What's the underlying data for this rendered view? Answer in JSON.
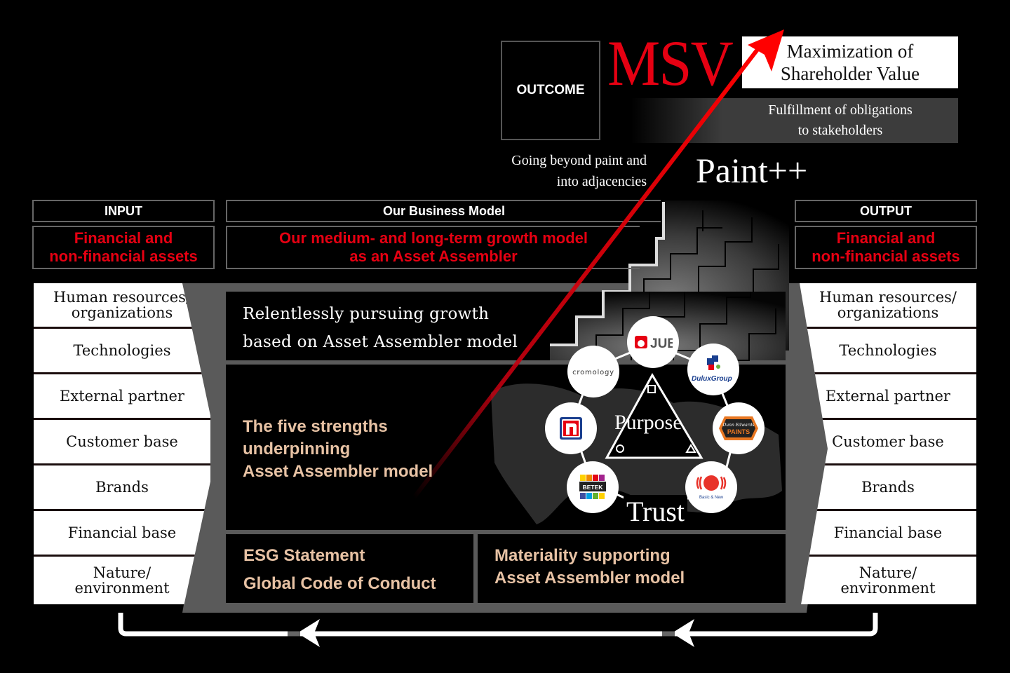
{
  "outcome": {
    "label": "OUTCOME",
    "msv": "MSV",
    "msv_full": [
      "Maximization of",
      "Shareholder Value"
    ],
    "fulfillment": [
      "Fulfillment of obligations",
      "to stakeholders"
    ],
    "going_beyond": [
      "Going beyond paint and",
      "into adjacencies"
    ],
    "paint_plus": "Paint++"
  },
  "input": {
    "header": "INPUT",
    "subheader": [
      "Financial and",
      "non-financial assets"
    ],
    "items": [
      [
        "Human resources/",
        "organizations"
      ],
      [
        "Technologies"
      ],
      [
        "External partner"
      ],
      [
        "Customer base"
      ],
      [
        "Brands"
      ],
      [
        "Financial base"
      ],
      [
        "Nature/",
        "environment"
      ]
    ]
  },
  "business_model": {
    "header": "Our Business Model",
    "subheader": [
      "Our medium- and long-term growth model",
      "as an Asset Assembler"
    ],
    "growth": [
      "Relentlessly pursuing growth",
      "based on Asset Assembler model"
    ],
    "strengths": [
      "The five strengths",
      "underpinning",
      "Asset Assembler model"
    ],
    "esg": [
      "ESG Statement",
      "Global Code of Conduct"
    ],
    "materiality": [
      "Materiality supporting",
      "Asset Assembler model"
    ],
    "purpose": "Purpose",
    "trust": "Trust",
    "brands": [
      {
        "name": "JUB",
        "icon": "jub-logo"
      },
      {
        "name": "DuluxGroup",
        "icon": "duluxgroup-logo"
      },
      {
        "name": "Dunn-Edwards PAINTS",
        "icon": "dunn-edwards-logo"
      },
      {
        "name": "Basic & New",
        "icon": "basic-new-logo"
      },
      {
        "name": "BETEK",
        "icon": "betek-logo"
      },
      {
        "name": "n",
        "icon": "nippon-paint-logo"
      },
      {
        "name": "cromology",
        "icon": "cromology-logo"
      }
    ]
  },
  "output": {
    "header": "OUTPUT",
    "subheader": [
      "Financial and",
      "non-financial assets"
    ],
    "items": [
      [
        "Human resources/",
        "organizations"
      ],
      [
        "Technologies"
      ],
      [
        "External partner"
      ],
      [
        "Customer base"
      ],
      [
        "Brands"
      ],
      [
        "Financial base"
      ],
      [
        "Nature/",
        "environment"
      ]
    ]
  },
  "colors": {
    "accent_red": "#e60012",
    "beige_text": "#e7c2a4",
    "panel_gray": "#5a5a5a"
  }
}
